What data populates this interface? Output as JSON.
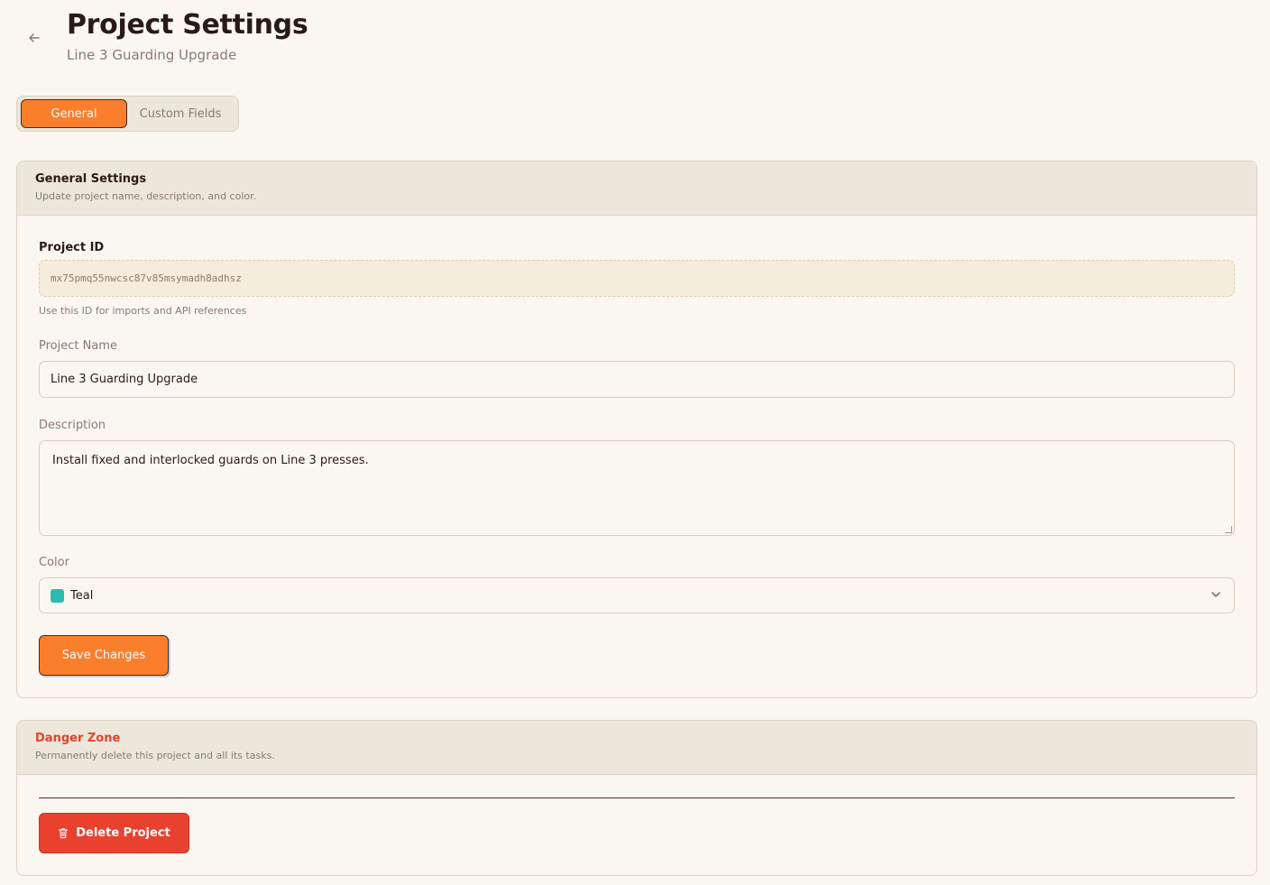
{
  "header": {
    "title": "Project Settings",
    "subtitle": "Line 3 Guarding Upgrade",
    "back_icon": "arrow-left-icon"
  },
  "tabs": [
    {
      "label": "General",
      "active": true
    },
    {
      "label": "Custom Fields",
      "active": false
    }
  ],
  "general": {
    "title": "General Settings",
    "description": "Update project name, description, and color.",
    "project_id": {
      "label": "Project ID",
      "value": "mx75pmq55nwcsc87v85msymadh8adhsz",
      "hint": "Use this ID for imports and API references"
    },
    "project_name": {
      "label": "Project Name",
      "value": "Line 3 Guarding Upgrade"
    },
    "description_field": {
      "label": "Description",
      "value": "Install fixed and interlocked guards on Line 3 presses."
    },
    "color": {
      "label": "Color",
      "value": "Teal",
      "swatch": "#2bbbad"
    },
    "save_label": "Save Changes"
  },
  "danger": {
    "title": "Danger Zone",
    "description": "Permanently delete this project and all its tasks.",
    "delete_label": "Delete Project"
  },
  "colors": {
    "accent": "#fb7e2d",
    "danger": "#e8422f"
  }
}
